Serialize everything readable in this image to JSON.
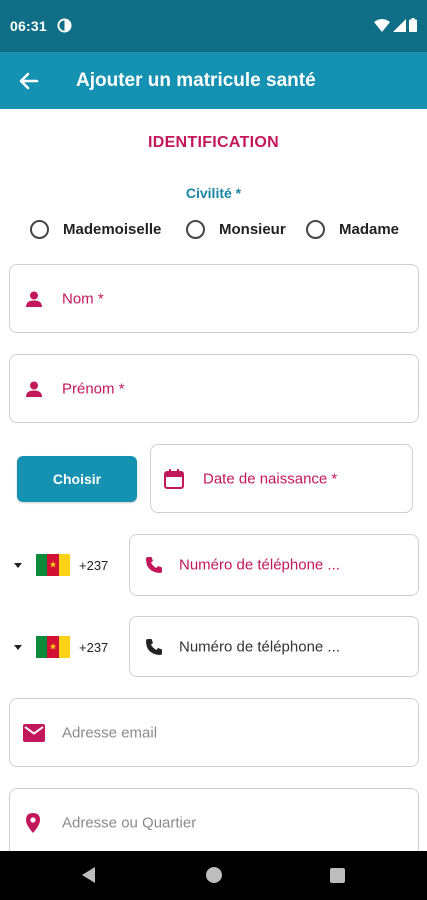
{
  "status_bar": {
    "time": "06:31"
  },
  "app_bar": {
    "title": "Ajouter un matricule santé"
  },
  "section": {
    "title": "IDENTIFICATION"
  },
  "civility": {
    "label": "Civilité *",
    "options": [
      "Mademoiselle",
      "Monsieur",
      "Madame"
    ]
  },
  "fields": {
    "nom": "Nom *",
    "prenom": "Prénom *",
    "birthdate": "Date de naissance *",
    "phone1": "Numéro de téléphone ...",
    "phone2": "Numéro de téléphone ...",
    "email": "Adresse email",
    "address": "Adresse ou Quartier"
  },
  "choose_button": {
    "label": "Choisir"
  },
  "country": {
    "dial_code": "+237"
  },
  "colors": {
    "primary": "#1591b2",
    "status_bar": "#0f6e86",
    "accent": "#c2185b"
  }
}
